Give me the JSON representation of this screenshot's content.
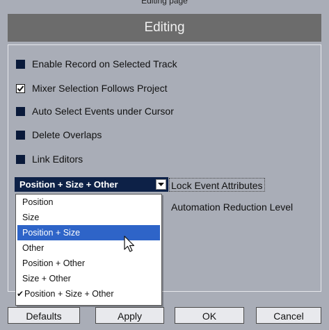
{
  "window": {
    "top_label": "Editing page",
    "header_title": "Editing"
  },
  "options": [
    {
      "label": "Enable Record on Selected Track",
      "checked": false
    },
    {
      "label": "Mixer Selection Follows Project",
      "checked": true
    },
    {
      "label": "Auto Select Events under Cursor",
      "checked": false
    },
    {
      "label": "Delete Overlaps",
      "checked": false
    },
    {
      "label": "Link Editors",
      "checked": false
    }
  ],
  "lock_attributes": {
    "selected_value": "Position + Size + Other",
    "label": "Lock Event Attributes"
  },
  "automation_reduction": {
    "label": "Automation Reduction Level"
  },
  "dropdown": {
    "items": [
      {
        "label": "Position",
        "highlighted": false,
        "checked": false
      },
      {
        "label": "Size",
        "highlighted": false,
        "checked": false
      },
      {
        "label": "Position + Size",
        "highlighted": true,
        "checked": false
      },
      {
        "label": "Other",
        "highlighted": false,
        "checked": false
      },
      {
        "label": "Position + Other",
        "highlighted": false,
        "checked": false
      },
      {
        "label": "Size + Other",
        "highlighted": false,
        "checked": false
      },
      {
        "label": "Position + Size + Other",
        "highlighted": false,
        "checked": true
      }
    ],
    "check_glyph": "✔"
  },
  "buttons": {
    "defaults": "Defaults",
    "apply": "Apply",
    "ok": "OK",
    "cancel": "Cancel"
  },
  "colors": {
    "background": "#a9adb7",
    "header": "#6c6c6c",
    "combo": "#0d2147",
    "highlight": "#2e64c8"
  },
  "icons": {
    "combo_arrow": "chevron-down-icon",
    "cursor": "mouse-pointer-icon",
    "check": "checkmark-icon"
  }
}
